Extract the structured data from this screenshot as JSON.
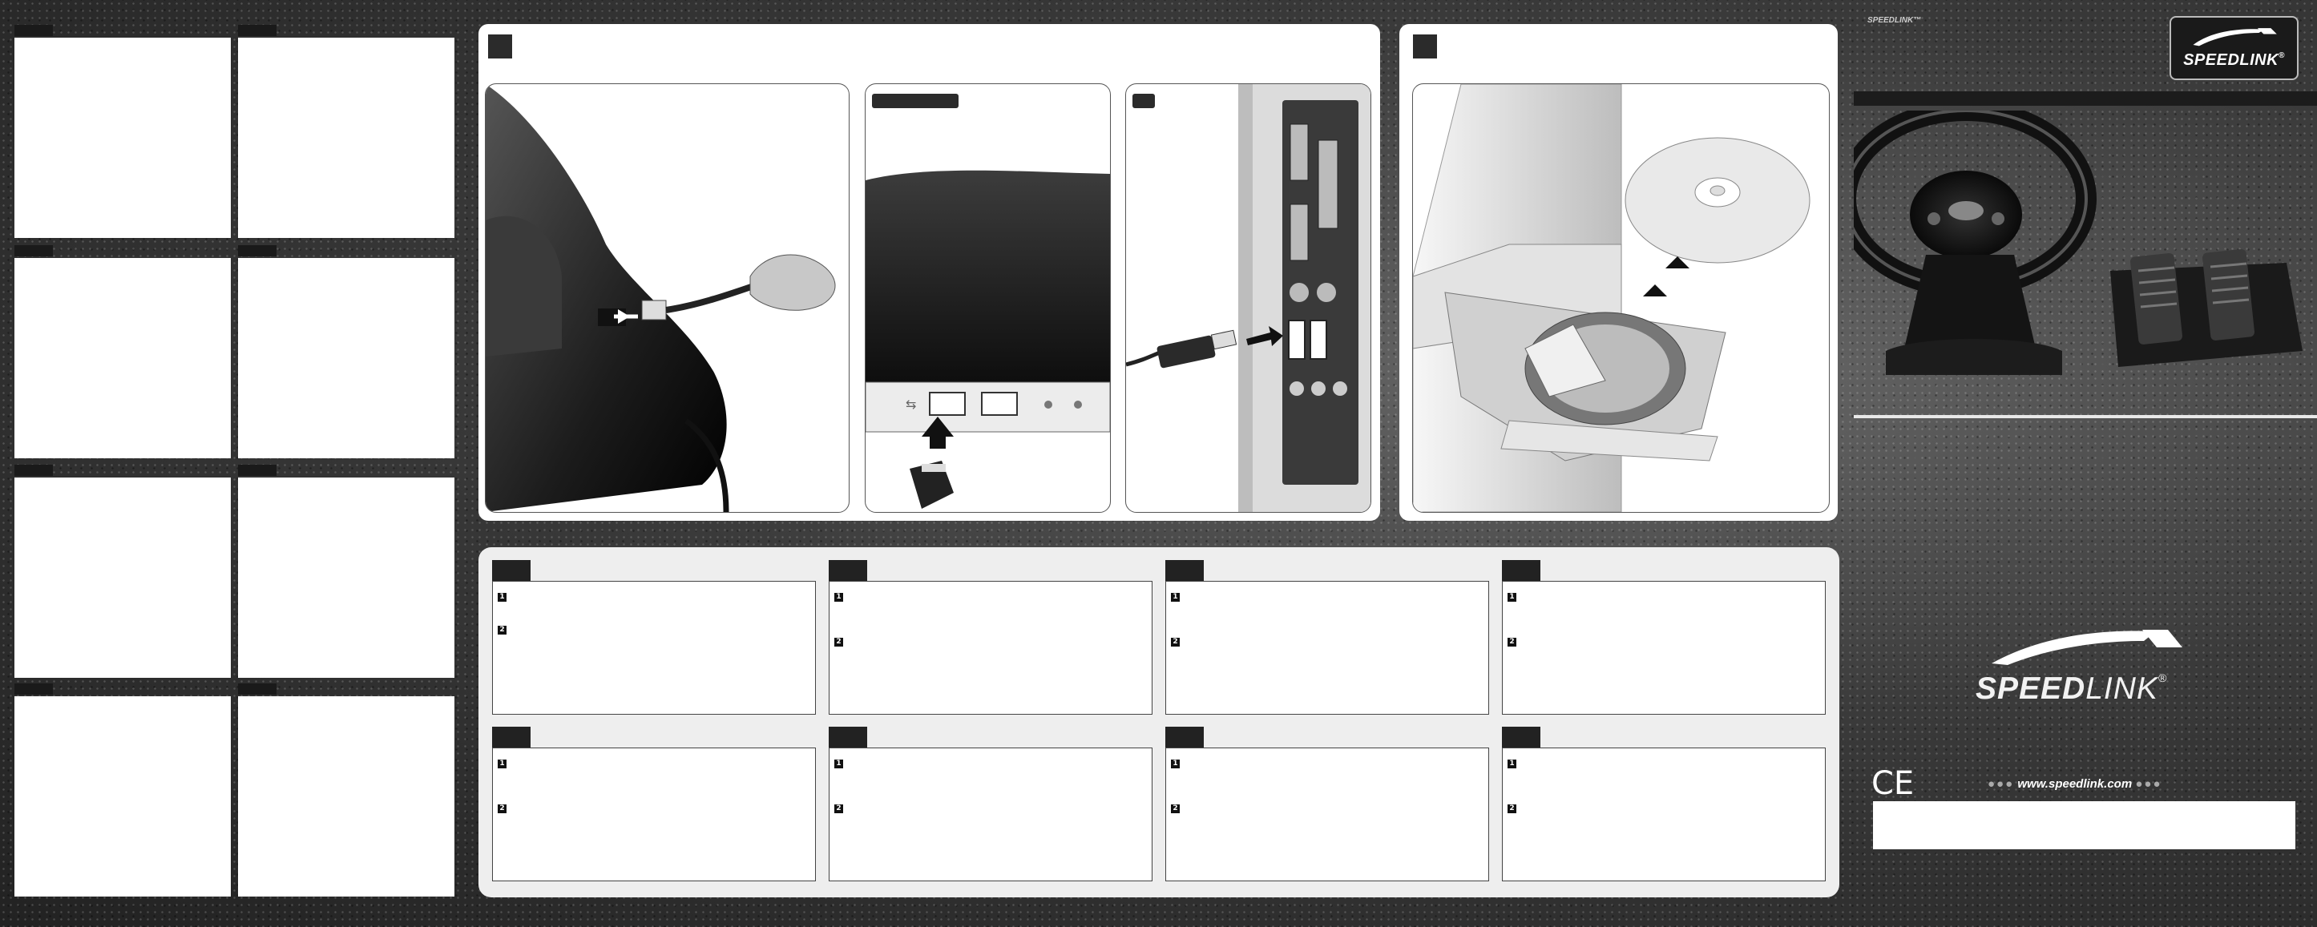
{
  "brand": {
    "name_bold": "SPEED",
    "name_light": "LINK",
    "registered": "®",
    "badge_label": "SPEEDLINK",
    "top_mini_label": "SPEEDLINK",
    "trademark": "™",
    "website": "www.speedlink.com",
    "dots_left": "●●●",
    "dots_right": "●●●",
    "ce_mark": "CE"
  },
  "panels": {
    "connection_step_number": "",
    "install_step_number": ""
  },
  "instructions": {
    "steps": [
      "1",
      "2"
    ],
    "boxes_count_note": ""
  },
  "icons": {
    "usb": "usb-icon",
    "cd": "cd-icon",
    "arrow": "arrow-icon"
  }
}
